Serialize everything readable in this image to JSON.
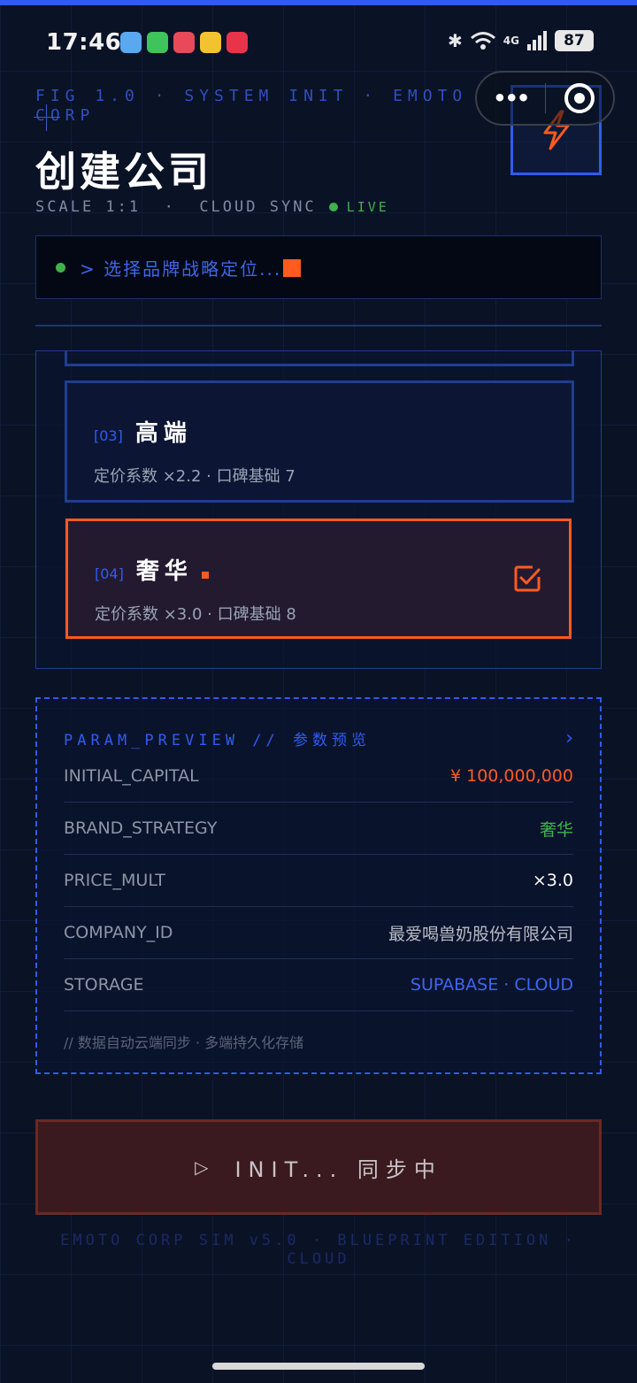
{
  "status_bar": {
    "time": "17:46",
    "network": "4G",
    "battery": "87",
    "app_icons": [
      "weather-icon",
      "phone-icon",
      "game-icon",
      "notes-icon",
      "social-icon"
    ]
  },
  "header": {
    "fig_line": "FIG 1.0   ·   SYSTEM INIT   ·   EMOTO CORP",
    "title": "创建公司",
    "scale": "SCALE 1:1",
    "sync": "CLOUD SYNC",
    "live": "LIVE"
  },
  "terminal": {
    "text": "> 选择品牌战略定位..."
  },
  "options": [
    {
      "num": "[03]",
      "name": "高端",
      "desc": "定价系数 ×2.2 · 口碑基础 7"
    },
    {
      "num": "[04]",
      "name": "奢华",
      "desc": "定价系数 ×3.0 · 口碑基础 8"
    }
  ],
  "params": {
    "title": "PARAM_PREVIEW  //  参数预览",
    "rows": [
      {
        "key": "INITIAL_CAPITAL",
        "value": "¥ 100,000,000"
      },
      {
        "key": "BRAND_STRATEGY",
        "value": "奢华"
      },
      {
        "key": "PRICE_MULT",
        "value": "×3.0"
      },
      {
        "key": "COMPANY_ID",
        "value": "最爱喝兽奶股份有限公司"
      },
      {
        "key": "STORAGE",
        "value": "SUPABASE · CLOUD"
      }
    ],
    "footnote": "// 数据自动云端同步 · 多端持久化存储"
  },
  "init_button": {
    "label": "INIT...  同步中"
  },
  "footer": {
    "text": "EMOTO CORP SIM v5.0  ·  BLUEPRINT EDITION  ·  CLOUD"
  },
  "colors": {
    "accent_blue": "#2f5cf0",
    "accent_orange": "#ff5a1f",
    "live_green": "#3fb24a",
    "background": "#0a1226"
  }
}
